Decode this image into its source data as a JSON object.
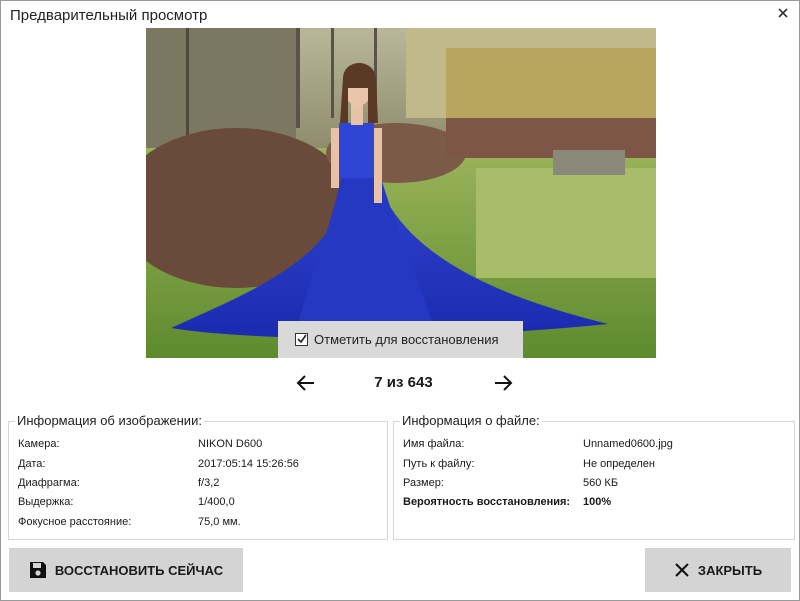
{
  "window": {
    "title": "Предварительный просмотр"
  },
  "preview": {
    "mark_for_restore_label": "Отметить для восстановления",
    "mark_checked": true
  },
  "pager": {
    "counter": "7 из 643"
  },
  "image_info": {
    "heading": "Информация об изображении:",
    "rows": [
      {
        "label": "Камера:",
        "value": "NIKON D600"
      },
      {
        "label": "Дата:",
        "value": "2017:05:14 15:26:56"
      },
      {
        "label": "Диафрагма:",
        "value": "f/3,2"
      },
      {
        "label": "Выдержка:",
        "value": "1/400,0"
      },
      {
        "label": "Фокусное расстояние:",
        "value": "75,0 мм."
      }
    ]
  },
  "file_info": {
    "heading": "Информация о файле:",
    "rows": [
      {
        "label": "Имя файла:",
        "value": "Unnamed0600.jpg"
      },
      {
        "label": "Путь к файлу:",
        "value": "Не определен"
      },
      {
        "label": "Размер:",
        "value": "560 КБ"
      },
      {
        "label": "Вероятность восстановления:",
        "value": "100%"
      }
    ]
  },
  "buttons": {
    "restore_now": "ВОССТАНОВИТЬ СЕЙЧАС",
    "close": "ЗАКРЫТЬ"
  },
  "icons": {
    "close": "close-icon",
    "prev": "arrow-left-icon",
    "next": "arrow-right-icon",
    "checkbox": "checkbox-checked-icon",
    "save": "floppy-disk-icon"
  }
}
